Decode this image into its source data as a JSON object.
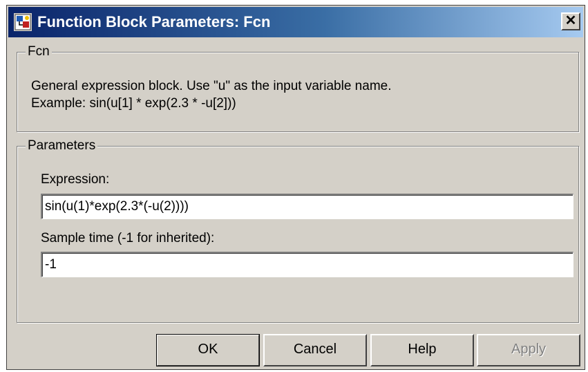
{
  "window": {
    "title": "Function Block Parameters: Fcn",
    "close_label": "✕"
  },
  "fcn_group": {
    "legend": "Fcn",
    "description_line1": "General expression block. Use \"u\" as the input variable name.",
    "description_line2": "Example: sin(u[1] * exp(2.3 * -u[2]))"
  },
  "parameters_group": {
    "legend": "Parameters",
    "expression_label": "Expression:",
    "expression_value": "sin(u(1)*exp(2.3*(-u(2))))",
    "sample_time_label": "Sample time (-1 for inherited):",
    "sample_time_value": "-1"
  },
  "buttons": {
    "ok": "OK",
    "cancel": "Cancel",
    "help": "Help",
    "apply": "Apply",
    "apply_enabled": false
  },
  "icons": {
    "app": "simulink-block-icon",
    "close": "close-icon"
  },
  "colors": {
    "title_gradient_start": "#0a246a",
    "title_gradient_end": "#a6caf0",
    "dialog_face": "#d4d0c8"
  }
}
